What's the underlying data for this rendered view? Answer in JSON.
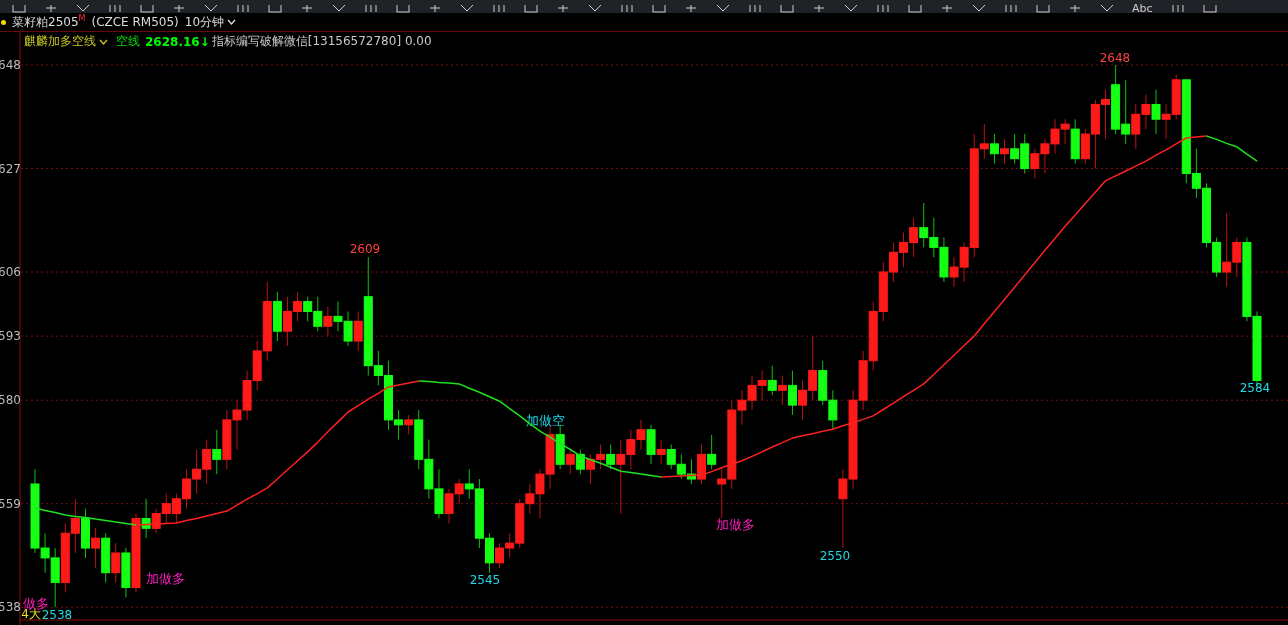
{
  "toolbar": {
    "label": "Abc"
  },
  "symbol_bar": {
    "name": "菜籽粕2505",
    "flag": "M",
    "code": "(CZCE RM505)",
    "period": "10分钟"
  },
  "indicator": {
    "name": "麒麟加多空线",
    "line_name": "空线",
    "line_value": "2628.16↓",
    "note": "指标编写破解微信[13156572780] 0.00"
  },
  "chart_data": {
    "type": "candlestick",
    "ylim": [
      535.4,
      654.7
    ],
    "yticks": [
      648,
      627,
      606,
      593,
      580,
      559,
      538
    ],
    "grid": true,
    "ohlc": [
      [
        563,
        566,
        549,
        550
      ],
      [
        550,
        553,
        545,
        548
      ],
      [
        548,
        550,
        538,
        543
      ],
      [
        543,
        555,
        541,
        553
      ],
      [
        553,
        560,
        549,
        556
      ],
      [
        556,
        558,
        548,
        550
      ],
      [
        550,
        554,
        546,
        552
      ],
      [
        552,
        553,
        543,
        545
      ],
      [
        545,
        551,
        543,
        549
      ],
      [
        549,
        550,
        540,
        542
      ],
      [
        542,
        557,
        541,
        556
      ],
      [
        556,
        560,
        552,
        554
      ],
      [
        554,
        558,
        553,
        557
      ],
      [
        557,
        561,
        555,
        559
      ],
      [
        557,
        561,
        555,
        560
      ],
      [
        560,
        566,
        558,
        564
      ],
      [
        564,
        570,
        561,
        566
      ],
      [
        566,
        572,
        563,
        570
      ],
      [
        570,
        574,
        565,
        568
      ],
      [
        568,
        578,
        566,
        576
      ],
      [
        576,
        580,
        570,
        578
      ],
      [
        578,
        586,
        576,
        584
      ],
      [
        584,
        592,
        582,
        590
      ],
      [
        590,
        604,
        588,
        600
      ],
      [
        600,
        602,
        592,
        594
      ],
      [
        594,
        601,
        591,
        598
      ],
      [
        598,
        602,
        596,
        600
      ],
      [
        600,
        601,
        596,
        598
      ],
      [
        598,
        601,
        594,
        595
      ],
      [
        595,
        599,
        593,
        597
      ],
      [
        597,
        600,
        594,
        596
      ],
      [
        596,
        598,
        591,
        592
      ],
      [
        592,
        598,
        590,
        596
      ],
      [
        601,
        609,
        585,
        587
      ],
      [
        587,
        590,
        583,
        585
      ],
      [
        585,
        588,
        574,
        576
      ],
      [
        576,
        578,
        572,
        575
      ],
      [
        575,
        577,
        573,
        576
      ],
      [
        576,
        578,
        566,
        568
      ],
      [
        568,
        572,
        560,
        562
      ],
      [
        562,
        566,
        556,
        557
      ],
      [
        557,
        562,
        555,
        561
      ],
      [
        561,
        564,
        559,
        563
      ],
      [
        563,
        566,
        560,
        562
      ],
      [
        562,
        564,
        550,
        552
      ],
      [
        552,
        553,
        545,
        547
      ],
      [
        547,
        551,
        546,
        550
      ],
      [
        550,
        553,
        548,
        551
      ],
      [
        551,
        560,
        550,
        559
      ],
      [
        559,
        563,
        557,
        561
      ],
      [
        561,
        566,
        556,
        565
      ],
      [
        565,
        575,
        562,
        573
      ],
      [
        573,
        575,
        566,
        567
      ],
      [
        567,
        570,
        565,
        569
      ],
      [
        569,
        570,
        565,
        566
      ],
      [
        566,
        569,
        563,
        568
      ],
      [
        568,
        571,
        566,
        569
      ],
      [
        569,
        571,
        566,
        567
      ],
      [
        567,
        572,
        557,
        569
      ],
      [
        569,
        574,
        566,
        572
      ],
      [
        572,
        576,
        570,
        574
      ],
      [
        574,
        575,
        567,
        569
      ],
      [
        569,
        572,
        567,
        570
      ],
      [
        570,
        571,
        566,
        567
      ],
      [
        567,
        569,
        564,
        565
      ],
      [
        565,
        568,
        563,
        564
      ],
      [
        564,
        571,
        563,
        569
      ],
      [
        569,
        573,
        566,
        567
      ],
      [
        563,
        566,
        556,
        564
      ],
      [
        564,
        580,
        562,
        578
      ],
      [
        578,
        582,
        575,
        580
      ],
      [
        580,
        585,
        578,
        583
      ],
      [
        583,
        586,
        580,
        584
      ],
      [
        584,
        587,
        581,
        582
      ],
      [
        582,
        585,
        579,
        583
      ],
      [
        583,
        586,
        577,
        579
      ],
      [
        579,
        584,
        576,
        582
      ],
      [
        582,
        593,
        580,
        586
      ],
      [
        586,
        588,
        579,
        580
      ],
      [
        580,
        582,
        574,
        576
      ],
      [
        560,
        566,
        550,
        564
      ],
      [
        564,
        582,
        562,
        580
      ],
      [
        580,
        590,
        578,
        588
      ],
      [
        588,
        600,
        586,
        598
      ],
      [
        598,
        608,
        596,
        606
      ],
      [
        606,
        612,
        604,
        610
      ],
      [
        610,
        614,
        607,
        612
      ],
      [
        612,
        617,
        609,
        615
      ],
      [
        615,
        620,
        611,
        613
      ],
      [
        613,
        617,
        609,
        611
      ],
      [
        611,
        613,
        604,
        605
      ],
      [
        605,
        609,
        603,
        607
      ],
      [
        607,
        612,
        604,
        611
      ],
      [
        611,
        634,
        609,
        631
      ],
      [
        631,
        636,
        629,
        632
      ],
      [
        632,
        634,
        628,
        630
      ],
      [
        630,
        633,
        628,
        631
      ],
      [
        631,
        634,
        628,
        629
      ],
      [
        632,
        634,
        626,
        627
      ],
      [
        627,
        631,
        625,
        630
      ],
      [
        630,
        633,
        626,
        632
      ],
      [
        632,
        637,
        630,
        635
      ],
      [
        635,
        637,
        632,
        636
      ],
      [
        635,
        637,
        628,
        629
      ],
      [
        629,
        635,
        628,
        634
      ],
      [
        634,
        641,
        627,
        640
      ],
      [
        640,
        643,
        633,
        641
      ],
      [
        644,
        648,
        634,
        635
      ],
      [
        636,
        645,
        632,
        634
      ],
      [
        634,
        640,
        631,
        638
      ],
      [
        638,
        642,
        635,
        640
      ],
      [
        640,
        643,
        634,
        637
      ],
      [
        637,
        640,
        633,
        638
      ],
      [
        638,
        646,
        637,
        645
      ],
      [
        645,
        645,
        624,
        626
      ],
      [
        626,
        631,
        621,
        623
      ],
      [
        623,
        624,
        611,
        612
      ],
      [
        612,
        613,
        605,
        606
      ],
      [
        606,
        618,
        603,
        608
      ],
      [
        608,
        613,
        605,
        612
      ],
      [
        612,
        613,
        596,
        597
      ],
      [
        597,
        598,
        583,
        584
      ]
    ]
  },
  "annotations": [
    {
      "text": "2609",
      "kind": "high"
    },
    {
      "text": "2648",
      "kind": "high"
    },
    {
      "text": "2545",
      "kind": "low"
    },
    {
      "text": "2550",
      "kind": "low"
    },
    {
      "text": "2584",
      "kind": "low"
    },
    {
      "text": "2538",
      "kind": "low"
    },
    {
      "text": "4大",
      "kind": "count"
    },
    {
      "text": "做多",
      "kind": "buy"
    },
    {
      "text": "加做多",
      "kind": "buy"
    },
    {
      "text": "加做多",
      "kind": "buy"
    },
    {
      "text": "加做空",
      "kind": "sell"
    }
  ]
}
